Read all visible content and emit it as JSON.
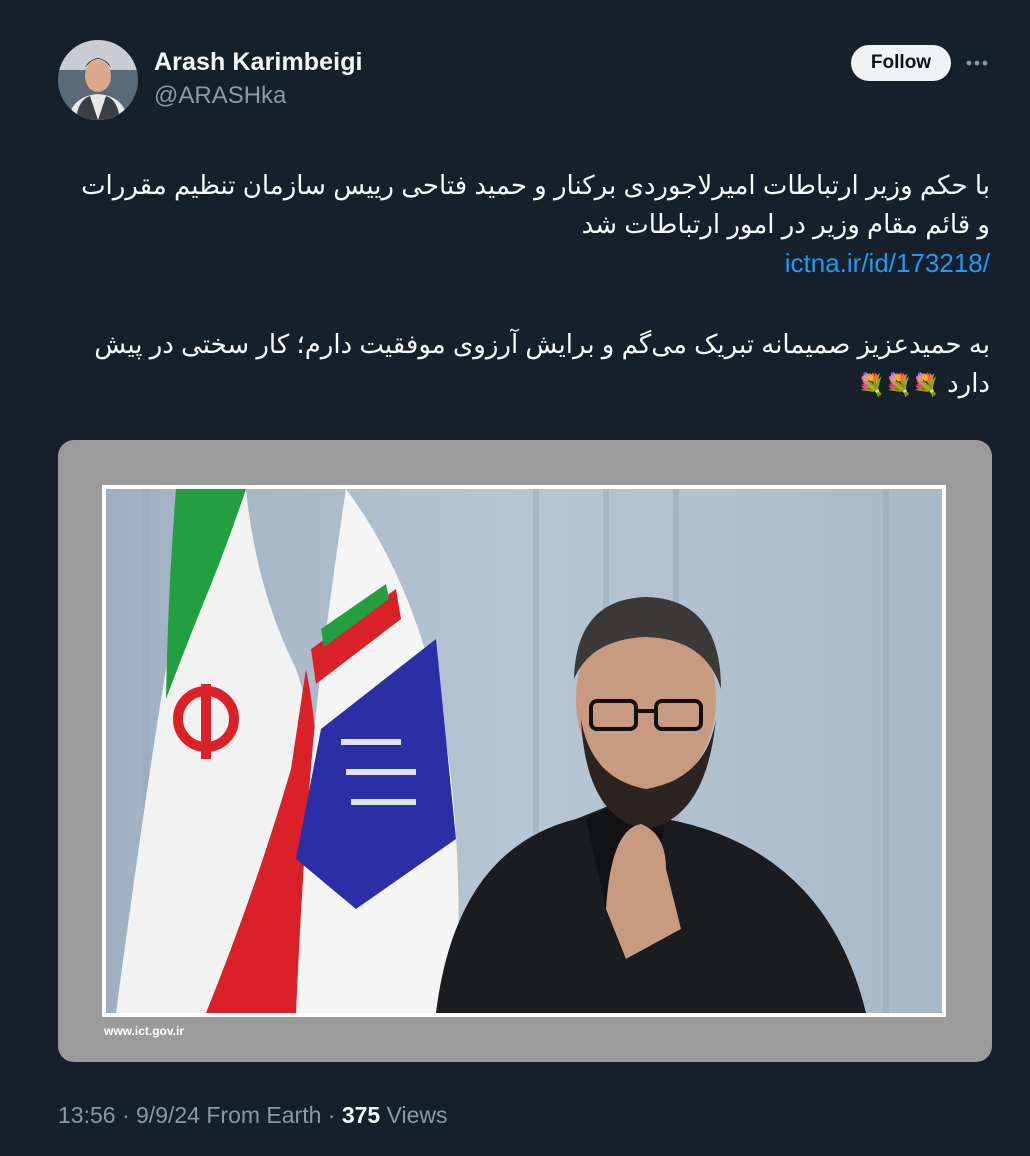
{
  "author": {
    "name": "Arash Karimbeigi",
    "handle": "@ARASHka"
  },
  "follow_label": "Follow",
  "tweet": {
    "line1": "با حکم وزیر ارتباطات امیرلاجوردی برکنار و حمید فتاحی رییس سازمان تنظیم مقررات",
    "line2": "و قائم مقام وزیر در امور ارتباطات شد",
    "link": "ictna.ir/id/173218/",
    "line3": "به حمیدعزیز صمیمانه تبریک می‌گم و برایش آرزوی موفقیت دارم؛ کار سختی در پیش",
    "line4": "دارد",
    "flowers": "💐💐💐"
  },
  "media": {
    "credit": "www.ict.gov.ir"
  },
  "meta": {
    "time": "13:56",
    "date": "9/9/24",
    "source": "From Earth",
    "views_count": "375",
    "views_label": "Views"
  },
  "colors": {
    "background": "#15202b",
    "link": "#1d9bf0",
    "muted": "#8b98a5"
  }
}
